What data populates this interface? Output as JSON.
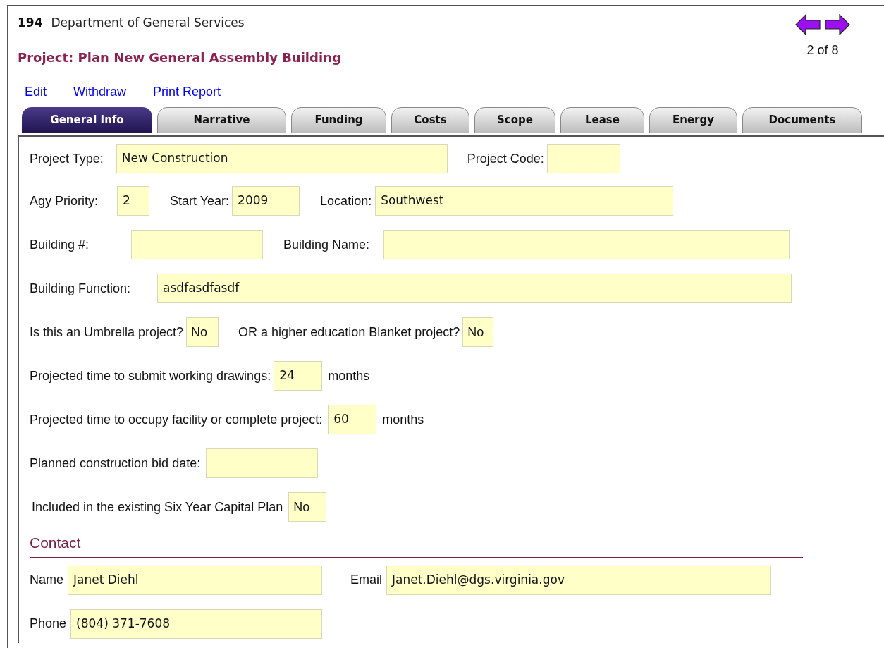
{
  "header": {
    "number": "194",
    "department": "Department of General Services",
    "project_title": "Project: Plan New General Assembly Building",
    "pager": "2 of 8"
  },
  "actions": [
    "Edit",
    "Withdraw",
    "Print Report"
  ],
  "tabs": [
    {
      "label": "General Info",
      "selected": true
    },
    {
      "label": "Narrative",
      "selected": false
    },
    {
      "label": "Funding",
      "selected": false
    },
    {
      "label": "Costs",
      "selected": false
    },
    {
      "label": "Scope",
      "selected": false
    },
    {
      "label": "Lease",
      "selected": false
    },
    {
      "label": "Energy",
      "selected": false
    },
    {
      "label": "Documents",
      "selected": false
    }
  ],
  "form_rows": [
    [
      {
        "kind": "label",
        "text": "Project Type:"
      },
      {
        "kind": "field",
        "value": "New Construction"
      },
      {
        "kind": "label",
        "text": "Project Code:"
      },
      {
        "kind": "field"
      }
    ],
    [
      {
        "kind": "label",
        "text": "Agy Priority:"
      },
      {
        "kind": "field",
        "value": "2"
      },
      {
        "kind": "label",
        "text": "Start Year:"
      },
      {
        "kind": "field",
        "value": "2009"
      },
      {
        "kind": "label",
        "text": "Location:"
      },
      {
        "kind": "field",
        "value": "Southwest"
      }
    ],
    [
      {
        "kind": "label",
        "text": "Building #:"
      },
      {
        "kind": "field"
      },
      {
        "kind": "label",
        "text": "Building Name:"
      },
      {
        "kind": "field"
      }
    ],
    [
      {
        "kind": "label",
        "text": "Building Function:"
      },
      {
        "kind": "field",
        "value": "asdfasdfasdf"
      }
    ],
    [
      {
        "kind": "label",
        "text": "Is this an Umbrella project?"
      },
      {
        "kind": "select",
        "value": "No"
      },
      {
        "kind": "label",
        "text": "OR a higher education Blanket project?"
      },
      {
        "kind": "select",
        "value": "No"
      }
    ],
    [
      {
        "kind": "label",
        "text": "Projected time to submit working drawings:"
      },
      {
        "kind": "field",
        "value": "24"
      },
      {
        "kind": "label",
        "text": "months"
      }
    ],
    [
      {
        "kind": "label",
        "text": "Projected time to occupy facility or complete project:"
      },
      {
        "kind": "field",
        "value": "60"
      },
      {
        "kind": "label",
        "text": "months"
      }
    ],
    [
      {
        "kind": "label",
        "text": "Planned construction bid date:"
      },
      {
        "kind": "field"
      }
    ],
    [
      {
        "kind": "label",
        "text": "Included in the existing Six Year Capital Plan"
      },
      {
        "kind": "select",
        "value": "No"
      }
    ]
  ],
  "contact": {
    "heading": "Contact",
    "rows": [
      [
        {
          "kind": "label",
          "text": "Name"
        },
        {
          "kind": "field",
          "value": "Janet Diehl"
        },
        {
          "kind": "label",
          "text": "Email"
        },
        {
          "kind": "field",
          "value": "Janet.Diehl@dgs.virginia.gov"
        }
      ],
      [
        {
          "kind": "label",
          "text": "Phone"
        },
        {
          "kind": "field",
          "value": "(804) 371-7608"
        }
      ]
    ]
  }
}
